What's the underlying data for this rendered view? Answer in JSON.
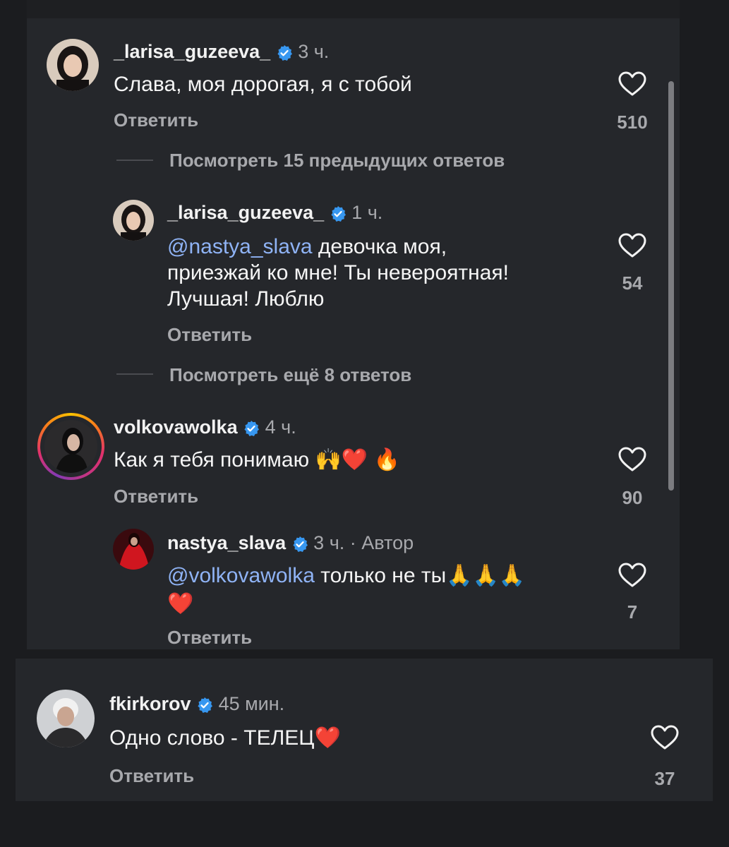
{
  "comments": [
    {
      "username": "_larisa_guzeeva_",
      "time": "3 ч.",
      "text": "Слава, моя дорогая, я с тобой",
      "reply_label": "Ответить",
      "likes": "510",
      "view_more": "Посмотреть 15 предыдущих ответов",
      "replies": [
        {
          "username": "_larisa_guzeeva_",
          "time": "1 ч.",
          "mention": "@nastya_slava",
          "text_line1": " девочка моя,",
          "text_line2": "приезжай ко мне! Ты невероятная!",
          "text_line3": "Лучшая! Люблю",
          "reply_label": "Ответить",
          "likes": "54",
          "view_more": "Посмотреть ещё 8 ответов"
        }
      ]
    },
    {
      "username": "volkovawolka",
      "time": "4 ч.",
      "text": "Как я тебя понимаю 🙌❤️ 🔥",
      "reply_label": "Ответить",
      "likes": "90",
      "replies": [
        {
          "username": "nastya_slava",
          "time": "3 ч. · Автор",
          "mention": "@volkovawolka",
          "text_line1": " только не ты🙏🙏🙏",
          "text_line2": "❤️",
          "reply_label": "Ответить",
          "likes": "7"
        }
      ]
    },
    {
      "username": "fkirkorov",
      "time": "45 мин.",
      "text": "Одно слово - ТЕЛЕЦ❤️",
      "reply_label": "Ответить",
      "likes": "37"
    }
  ],
  "colors": {
    "background": "#1b1c1f",
    "panel": "#25272b",
    "verified": "#3797f0",
    "mention": "#8fb3f5",
    "secondary_text": "#a8a9ad"
  },
  "icons": [
    "verified-badge-icon",
    "heart-outline-icon"
  ]
}
